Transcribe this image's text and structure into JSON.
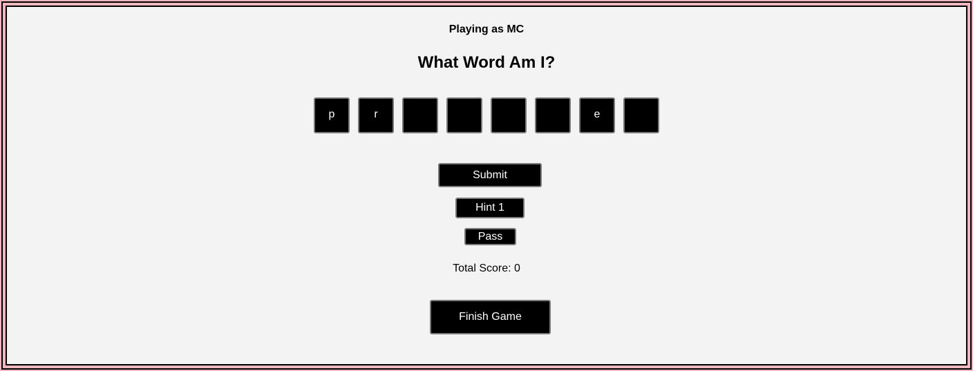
{
  "player": {
    "label": "Playing as MC"
  },
  "game": {
    "title": "What Word Am I?",
    "tiles": [
      "p",
      "r",
      "",
      "",
      "",
      "",
      "e",
      ""
    ]
  },
  "actions": {
    "submit_label": "Submit",
    "hint_label": "Hint 1",
    "pass_label": "Pass",
    "finish_label": "Finish Game"
  },
  "score": {
    "text": "Total Score: 0"
  },
  "colors": {
    "outer_border": "#f0b8be",
    "panel_background": "#f3f3f3",
    "tile_background": "#000000",
    "button_background": "#000000",
    "button_border": "#7a7a7a"
  }
}
